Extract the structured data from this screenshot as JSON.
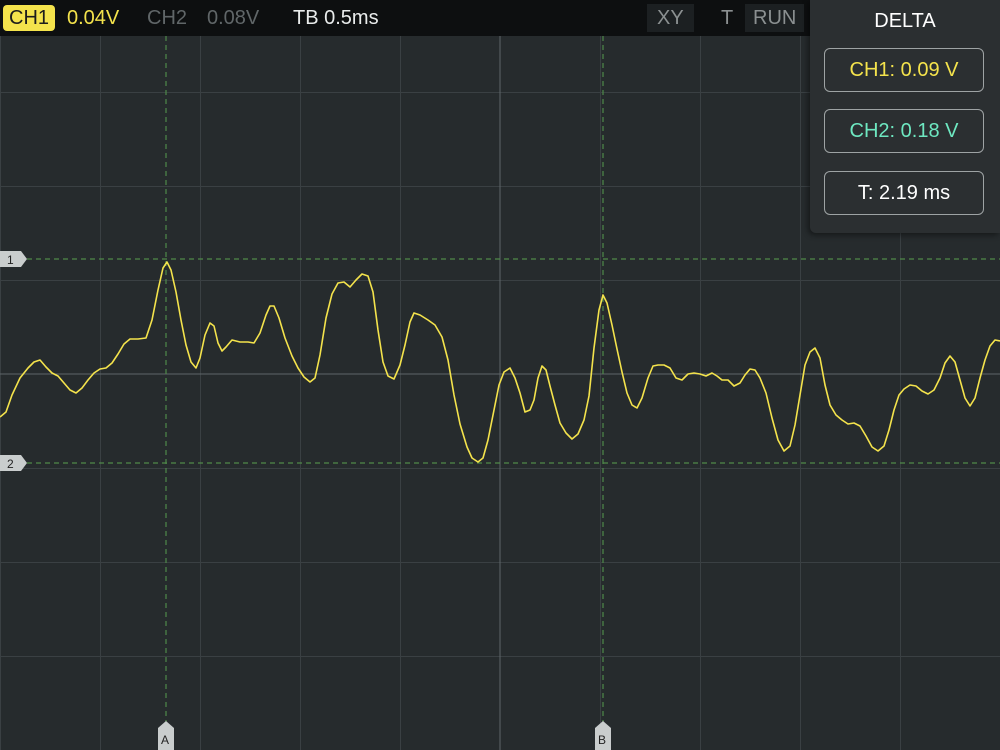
{
  "toolbar": {
    "ch1_label": "CH1",
    "ch1_scale": "0.04V",
    "ch2_label": "CH2",
    "ch2_scale": "0.08V",
    "timebase": "TB 0.5ms",
    "xy_label": "XY",
    "trigger_label": "T",
    "run_label": "RUN"
  },
  "delta_panel": {
    "title": "DELTA",
    "ch1": "CH1: 0.09 V",
    "ch2": "CH2: 0.18 V",
    "time": "T: 2.19 ms"
  },
  "markers": {
    "level_1": "1",
    "level_2": "2",
    "cursor_a": "A",
    "cursor_b": "B"
  },
  "colors": {
    "background": "#262b2d",
    "grid": "#3a4043",
    "trace_ch1": "#f4e34c",
    "ch2": "#6ee8c1",
    "cursor": "#4f8a4a",
    "toolbar": "#0d0f10"
  }
}
